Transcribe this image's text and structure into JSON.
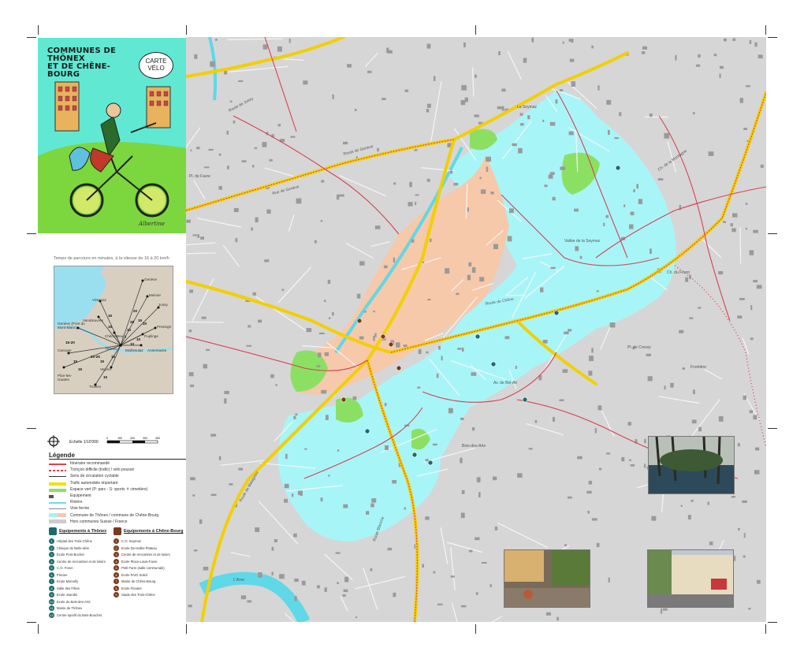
{
  "cover": {
    "title_line1": "COMMUNES DE THÔNEX",
    "title_line2": "ET DE CHÊNE-BOURG",
    "bubble_line1": "CARTE",
    "bubble_line2": "VÉLO",
    "signature": "Albertine"
  },
  "travel_time": {
    "caption": "Temps de parcours en minutes, à la vitesse de 16 à 20 km/h",
    "places": [
      "Genève",
      "Meinier",
      "Vésenaz",
      "Jussy",
      "Vandœuvres",
      "Presinge",
      "Genève (Pont du Mont-Blanc)",
      "Puplinge",
      "Chêne-Bourg",
      "Moillesulaz",
      "Annemasse",
      "Carouge",
      "Thônex",
      "Veyrier",
      "Plan-les-Ouates",
      "Troinex"
    ],
    "minutes": [
      "20",
      "15",
      "15",
      "20",
      "25",
      "10",
      "15",
      "10",
      "15-20",
      "20-25",
      "10",
      "15",
      "15",
      "15",
      "15",
      "15"
    ]
  },
  "scale": {
    "label": "Echelle 1/10'000",
    "ticks": [
      "0",
      "100",
      "200",
      "300",
      "400"
    ]
  },
  "legend": {
    "title": "Légende",
    "items": [
      {
        "label": "Itinéraire recommandé",
        "color": "#d94050"
      },
      {
        "label": "Tronçon difficile (trafic) / vélo poussé",
        "color": "#d94050"
      },
      {
        "label": "Sens de circulation cyclable",
        "color": "#333333"
      },
      {
        "label": "Trafic automobile important",
        "color": "#f2e200"
      },
      {
        "label": "Espace vert (P: parc - S: sports ✝ cimetière)",
        "color": "#8be064"
      },
      {
        "label": "Equipement",
        "color": "#555555"
      },
      {
        "label": "Rivière",
        "color": "#66e0e8"
      },
      {
        "label": "Voie ferrée",
        "color": "#888888"
      },
      {
        "label": "Commune de Thônex / commune de Chêne-Bourg",
        "color": "#a8f0f4"
      },
      {
        "label": "Hors communes Suisse / France",
        "color": "#cccccc"
      }
    ]
  },
  "equipment": {
    "thonex_title": "Equipements à Thônex",
    "chene_title": "Equipements à Chêne-Bourg",
    "thonex_items": [
      "Hôpital des Trois-Chêne",
      "Clinique de Belle-Idée",
      "Ecole Pont-Bochet",
      "Centre de rencontres et de loisirs",
      "C.O. Foron",
      "Piscine",
      "Ecole Marcelly",
      "Salle des Fêtes",
      "Ecole Jeandin",
      "Ecole du Bois-des-Arts",
      "Mairie de Thônex",
      "Centre sportif du Bois-Bouchet"
    ],
    "chene_items": [
      "C.O. Seymaz",
      "Ecole De-Haller-Plateau",
      "Centre de rencontres et de loisirs",
      "Ecole Place-Louis-Favre",
      "Petit Farm (salle communale)",
      "Ecole PAIG Soleil",
      "Mairie de Chêne-Bourg",
      "Ecole Floraire",
      "Stade des Trois-Chêne"
    ],
    "thonex_color": "#1c6b6b",
    "chene_color": "#7a3a1c"
  },
  "map": {
    "street_labels": [
      "Route de Jussy",
      "Ch. de la Montagne",
      "Route de Malagnou",
      "Route de Chêne",
      "Route de Genève",
      "Rue de Genève",
      "Av. de Bel-Air",
      "Ch. du Foron",
      "Route Blanche",
      "La Seymaz",
      "L'Arve",
      "Vallée de la Seymaz",
      "Pl. de Favre",
      "Pl. de Cressy",
      "Frontière",
      "Bois-des-Arts"
    ],
    "colors": {
      "thonex": "#a8f5f8",
      "chene": "#f6c9aa",
      "outside": "#d6d6d6",
      "main_road": "#f2cf00",
      "route": "#d94050",
      "green": "#8be064",
      "river": "#5fd8e8"
    }
  }
}
